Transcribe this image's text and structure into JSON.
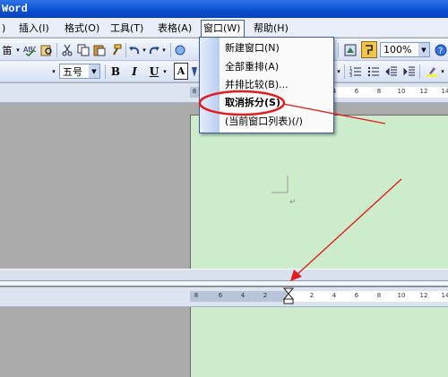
{
  "window": {
    "title": "Word"
  },
  "menubar": {
    "items": [
      {
        "label": ")"
      },
      {
        "label": "插入(I)"
      },
      {
        "label": "格式(O)"
      },
      {
        "label": "工具(T)"
      },
      {
        "label": "表格(A)"
      },
      {
        "label": "窗口(W)",
        "active": true
      },
      {
        "label": "帮助(H)"
      }
    ]
  },
  "window_menu": {
    "items": [
      {
        "label": "新建窗口(N)"
      },
      {
        "label": "全部重排(A)"
      },
      {
        "label": "并排比较(B)..."
      },
      {
        "label": "取消拆分(S)",
        "highlighted": true
      },
      {
        "label": "(当前窗口列表)(/)"
      }
    ]
  },
  "toolbar1": {
    "first_glyph": "笛",
    "zoom_value": "100%"
  },
  "toolbar2": {
    "font_size": "五号",
    "bold": "B",
    "italic": "I",
    "underline": "U",
    "font_color": "A"
  },
  "ruler_top": {
    "labels": [
      "8",
      "4",
      "6",
      "8",
      "10",
      "12",
      "14"
    ]
  },
  "ruler_bottom": {
    "labels": [
      "8",
      "6",
      "4",
      "2",
      "2",
      "4",
      "6",
      "8",
      "10",
      "12",
      "14"
    ]
  },
  "document": {
    "return_mark": "↵"
  },
  "colors": {
    "page": "#cdeccc",
    "annotation": "#e21d1d",
    "title_bar": "#0a4fd1"
  }
}
